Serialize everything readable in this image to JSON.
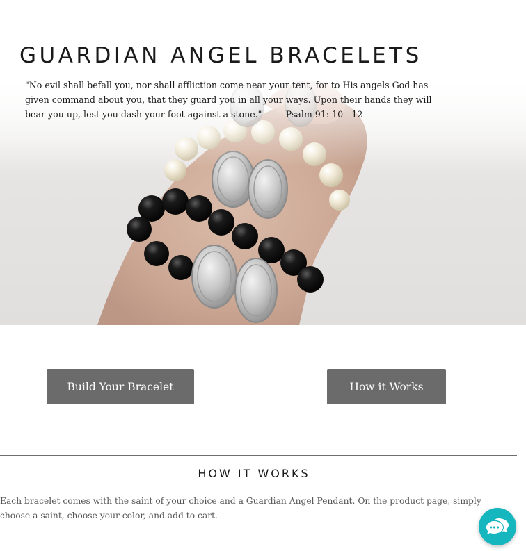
{
  "hero": {
    "title": "GUARDIAN ANGEL BRACELETS",
    "quote": "\"No evil shall befall you, nor shall affliction come near your tent, for to His angels God has given command about you, that they guard you in all your ways. Upon their hands they will bear you up, lest you dash your foot against a stone.\"",
    "citation": "- Psalm 91: 10 - 12",
    "image_icon": "bracelets-on-wrist-photo"
  },
  "buttons": {
    "build_label": "Build Your Bracelet",
    "how_label": "How it Works"
  },
  "how_it_works": {
    "title": "HOW IT WORKS",
    "body": "Each bracelet comes with the saint of your choice and a Guardian Angel Pendant. On the product page, simply choose a saint, choose your color, and add to cart."
  },
  "chat": {
    "icon": "chat-bubbles-icon"
  },
  "colors": {
    "button_bg": "#6b6b6b",
    "chat_accent": "#16b6bf",
    "text": "#1a1a1a",
    "muted_text": "#555555"
  }
}
